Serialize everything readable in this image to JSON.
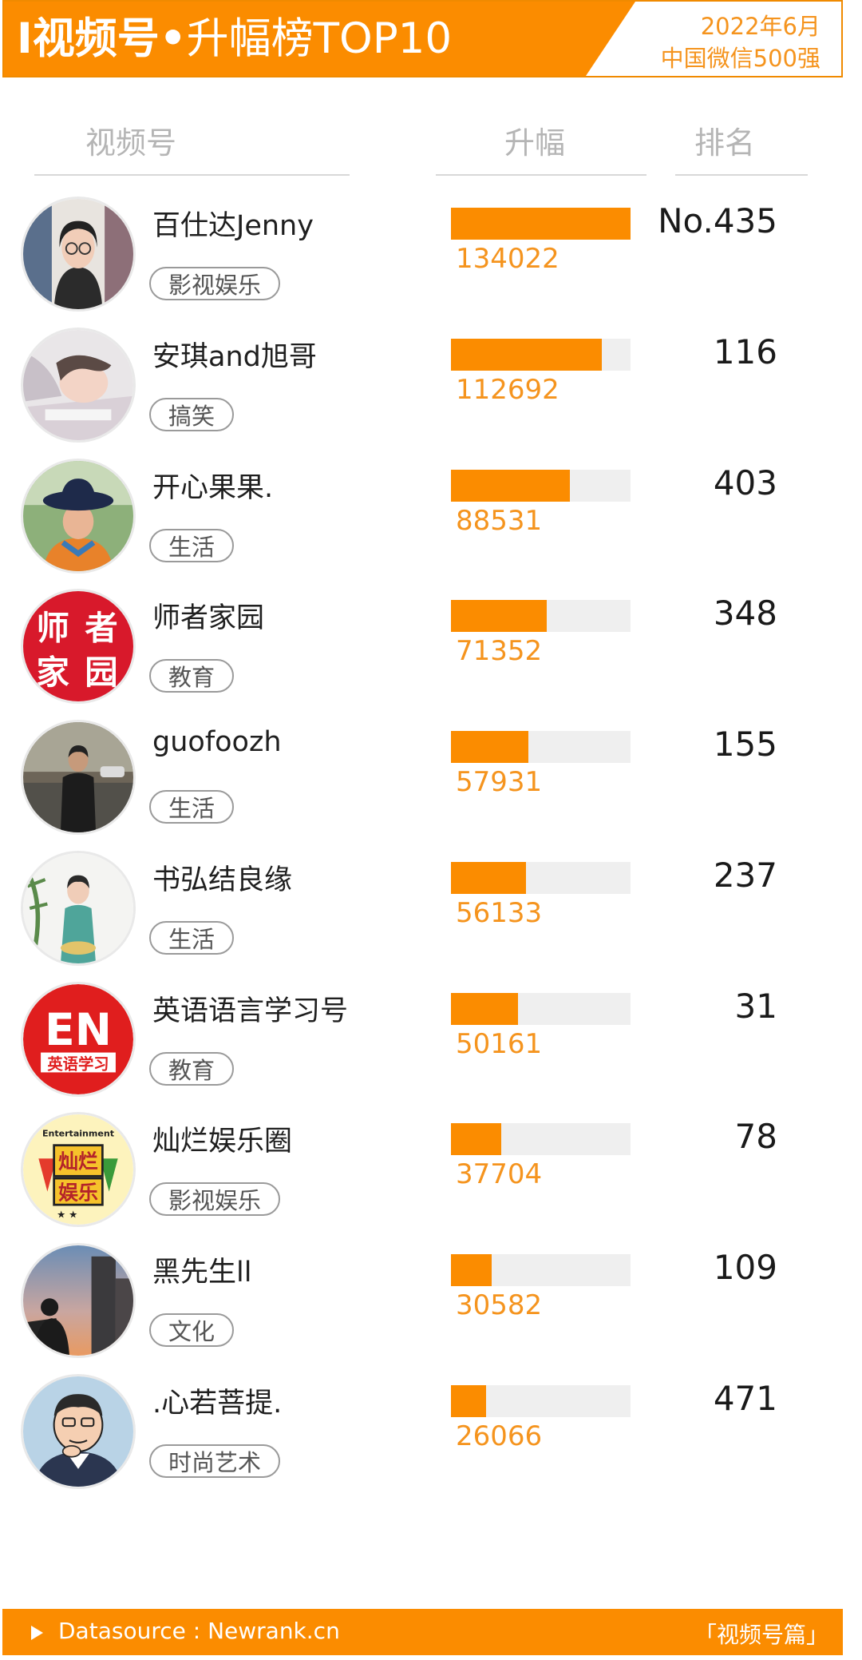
{
  "header": {
    "title_bold": "I视频号•",
    "title_rest": "升幅榜TOP10",
    "date_line1": "2022年6月",
    "date_line2": "中国微信500强"
  },
  "columns": {
    "account": "视频号",
    "growth": "升幅",
    "rank": "排名"
  },
  "footer": {
    "source": "Datasource : Newrank.cn",
    "tagline": "「视频号篇」"
  },
  "chart_data": {
    "type": "bar",
    "orientation": "horizontal",
    "xlim": [
      0,
      134022
    ],
    "categories": [
      "百仕达Jenny",
      "安琪and旭哥",
      "开心果果.",
      "师者家园",
      "guofoozh",
      "书弘结良缘",
      "英语语言学习号",
      "灿烂娱乐圈",
      "黑先生ll",
      ".心若菩提."
    ],
    "values": [
      134022,
      112692,
      88531,
      71352,
      57931,
      56133,
      50161,
      37704,
      30582,
      26066
    ]
  },
  "rows": [
    {
      "name": "百仕达Jenny",
      "tag": "影视娱乐",
      "value": "134022",
      "rank": "No.435",
      "avatar": "woman-glasses"
    },
    {
      "name": "安琪and旭哥",
      "tag": "搞笑",
      "value": "112692",
      "rank": "116",
      "avatar": "woman-lying"
    },
    {
      "name": "开心果果.",
      "tag": "生活",
      "value": "88531",
      "rank": "403",
      "avatar": "woman-hat"
    },
    {
      "name": "师者家园",
      "tag": "教育",
      "value": "71352",
      "rank": "348",
      "avatar": "calligraphy-logo",
      "avatar_text": [
        "师",
        "者",
        "家",
        "园"
      ]
    },
    {
      "name": "guofoozh",
      "tag": "生活",
      "value": "57931",
      "rank": "155",
      "avatar": "man-street"
    },
    {
      "name": "书弘结良缘",
      "tag": "生活",
      "value": "56133",
      "rank": "237",
      "avatar": "woman-qipao"
    },
    {
      "name": "英语语言学习号",
      "tag": "教育",
      "value": "50161",
      "rank": "31",
      "avatar": "en-logo",
      "avatar_text": [
        "EN",
        "英语学习"
      ]
    },
    {
      "name": "灿烂娱乐圈",
      "tag": "影视娱乐",
      "value": "37704",
      "rank": "78",
      "avatar": "entertainment-logo",
      "avatar_text": [
        "Entertainment",
        "灿烂",
        "娱乐"
      ]
    },
    {
      "name": "黑先生ll",
      "tag": "文化",
      "value": "30582",
      "rank": "109",
      "avatar": "city-sunset"
    },
    {
      "name": ".心若菩提.",
      "tag": "时尚艺术",
      "value": "26066",
      "rank": "471",
      "avatar": "cartoon-man"
    }
  ],
  "colors": {
    "accent": "#fb8c00",
    "value_text": "#f5941e",
    "track": "#efefef"
  }
}
